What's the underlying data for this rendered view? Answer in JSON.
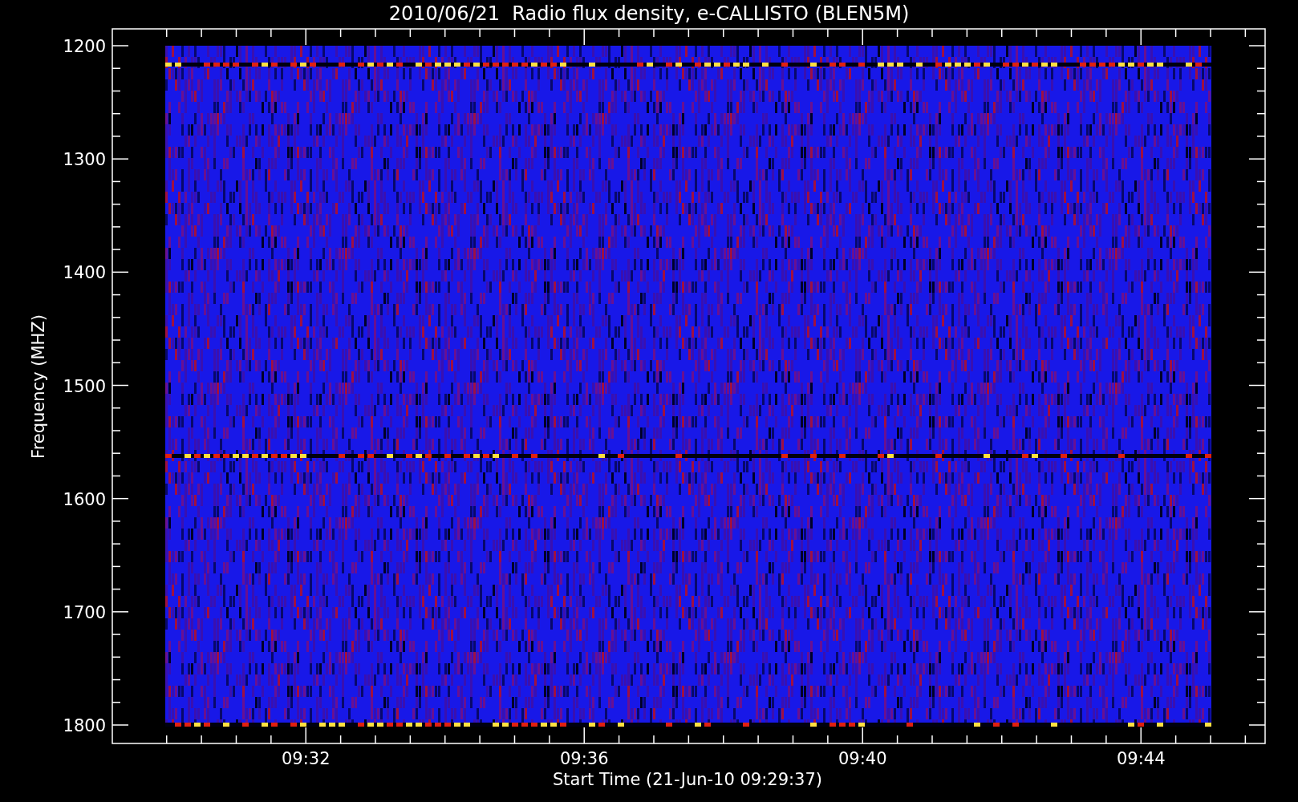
{
  "title": "2010/06/21  Radio flux density, e-CALLISTO (BLEN5M)",
  "ylabel": "Frequency (MHZ)",
  "xlabel": "Start Time (21-Jun-10 09:29:37)",
  "yticks": [
    "1200",
    "1300",
    "1400",
    "1500",
    "1600",
    "1700",
    "1800"
  ],
  "xticks": [
    "09:32",
    "09:36",
    "09:40",
    "09:44"
  ]
}
